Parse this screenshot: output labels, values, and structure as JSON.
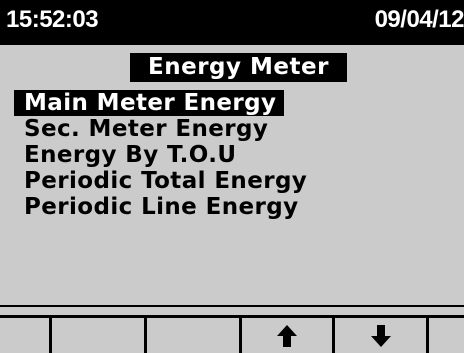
{
  "status_bar": {
    "time": "15:52:03",
    "date": "09/04/12"
  },
  "screen": {
    "title": "Energy Meter"
  },
  "menu": {
    "items": [
      {
        "label": "Main Meter Energy",
        "selected": true
      },
      {
        "label": "Sec. Meter Energy",
        "selected": false
      },
      {
        "label": "Energy By T.O.U",
        "selected": false
      },
      {
        "label": "Periodic Total Energy",
        "selected": false
      },
      {
        "label": "Periodic Line Energy",
        "selected": false
      }
    ]
  },
  "softkeys": [
    {
      "icon": "none"
    },
    {
      "icon": "none"
    },
    {
      "icon": "none"
    },
    {
      "icon": "up-arrow-icon"
    },
    {
      "icon": "down-arrow-icon"
    },
    {
      "icon": "none"
    }
  ],
  "colors": {
    "background": "#cbcbcb",
    "foreground": "#000000",
    "highlight_text": "#ffffff"
  }
}
